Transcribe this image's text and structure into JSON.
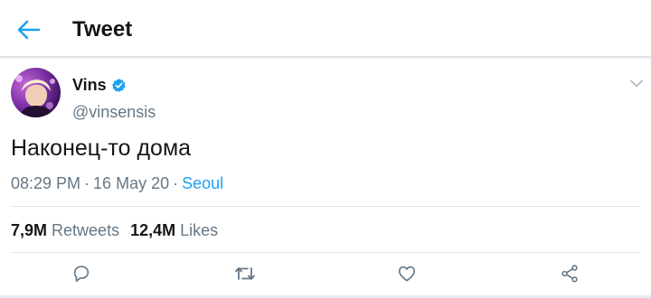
{
  "header": {
    "title": "Tweet",
    "back_icon": "arrow-left-icon"
  },
  "tweet": {
    "author": {
      "display_name": "Vins",
      "handle": "@vinsensis",
      "verified": true
    },
    "text": "Наконец-то дома",
    "time": "08:29 PM",
    "date": "16 May 20",
    "separator": "·",
    "location": "Seoul",
    "stats": {
      "retweets_count": "7,9M",
      "retweets_label": "Retweets",
      "likes_count": "12,4M",
      "likes_label": "Likes"
    },
    "actions": [
      "reply-icon",
      "retweet-icon",
      "like-icon",
      "share-icon"
    ]
  },
  "colors": {
    "accent": "#1da1f2",
    "text": "#14171a",
    "secondary": "#657786",
    "divider": "#dfe3e7"
  }
}
